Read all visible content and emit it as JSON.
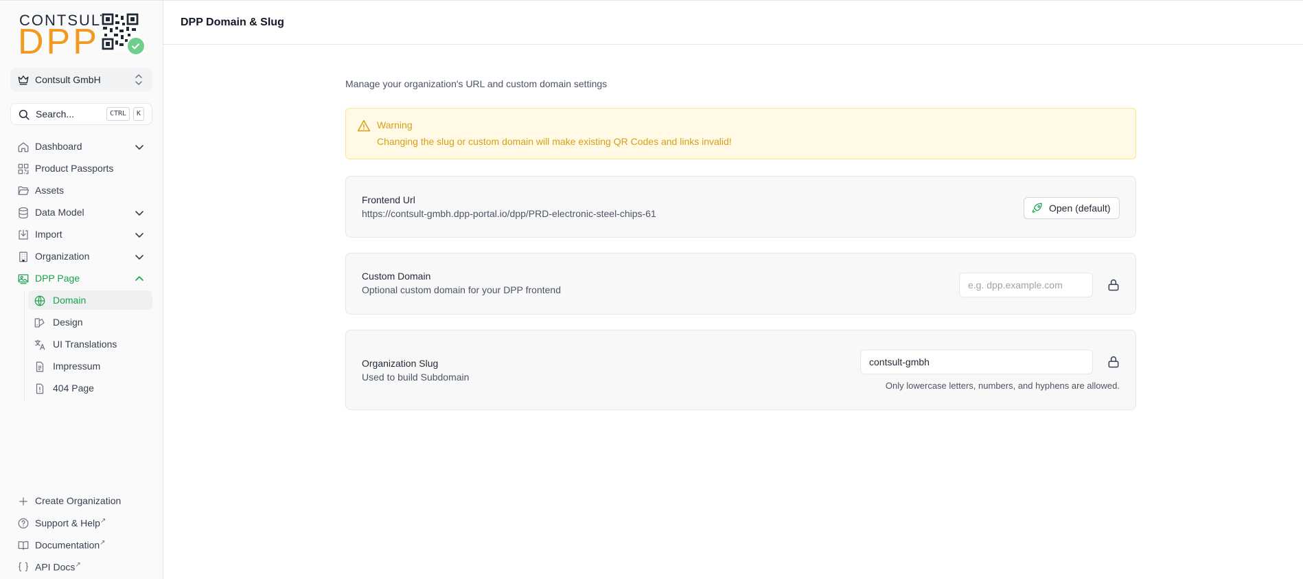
{
  "sidebar": {
    "logo": {
      "top": "CONTSULT",
      "main": "DPP"
    },
    "org_switch": {
      "name": "Contsult GmbH"
    },
    "search": {
      "label": "Search...",
      "kbd1": "CTRL",
      "kbd2": "K"
    },
    "nav": [
      {
        "label": "Dashboard",
        "icon": "home-icon",
        "has_chevron": true
      },
      {
        "label": "Product Passports",
        "icon": "qr-icon",
        "has_chevron": false
      },
      {
        "label": "Assets",
        "icon": "folder-open-icon",
        "has_chevron": false
      },
      {
        "label": "Data Model",
        "icon": "database-icon",
        "has_chevron": true
      },
      {
        "label": "Import",
        "icon": "import-icon",
        "has_chevron": true
      },
      {
        "label": "Organization",
        "icon": "building-icon",
        "has_chevron": true
      },
      {
        "label": "DPP Page",
        "icon": "image-gallery-icon",
        "has_chevron": true,
        "expanded": true
      }
    ],
    "sub_nav": [
      {
        "label": "Domain",
        "icon": "globe-icon",
        "active": true
      },
      {
        "label": "Design",
        "icon": "palette-icon"
      },
      {
        "label": "UI Translations",
        "icon": "languages-icon"
      },
      {
        "label": "Impressum",
        "icon": "file-text-icon"
      },
      {
        "label": "404 Page",
        "icon": "file-warning-icon"
      }
    ],
    "footer": [
      {
        "label": "Create Organization",
        "icon": "plus-icon",
        "external": false
      },
      {
        "label": "Support & Help",
        "icon": "help-circle-icon",
        "external": true
      },
      {
        "label": "Documentation",
        "icon": "book-icon",
        "external": true
      },
      {
        "label": "API Docs",
        "icon": "braces-icon",
        "external": true
      }
    ],
    "external_mark": "↗"
  },
  "header": {
    "title": "DPP Domain & Slug"
  },
  "main": {
    "subtitle": "Manage your organization's URL and custom domain settings",
    "warning": {
      "title": "Warning",
      "text": "Changing the slug or custom domain will make existing QR Codes and links invalid!"
    },
    "frontend_url": {
      "title": "Frontend Url",
      "url": "https://contsult-gmbh.dpp-portal.io/dpp/PRD-electronic-steel-chips-61",
      "button": "Open (default)"
    },
    "custom_domain": {
      "title": "Custom Domain",
      "description": "Optional custom domain for your DPP frontend",
      "placeholder": "e.g. dpp.example.com",
      "value": ""
    },
    "org_slug": {
      "title": "Organization Slug",
      "description": "Used to build Subdomain",
      "value": "contsult-gmbh",
      "hint": "Only lowercase letters, numbers, and hyphens are allowed."
    }
  },
  "colors": {
    "accent": "#16a34a",
    "brand_orange": "#f29a1f",
    "warning": "#d4a017"
  }
}
